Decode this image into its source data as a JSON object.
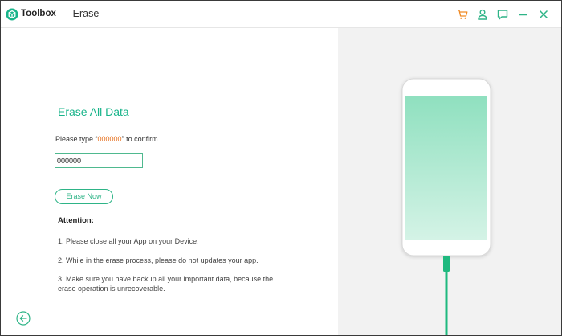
{
  "titlebar": {
    "app_name": "Toolbox",
    "separator_title": "- Erase",
    "icons": [
      "logo-icon",
      "cart-icon",
      "user-icon",
      "feedback-icon",
      "minimize-icon",
      "close-icon"
    ]
  },
  "main": {
    "heading": "Erase All Data",
    "confirm_prefix": "Please type “",
    "confirm_code": "000000",
    "confirm_suffix": "” to confirm",
    "input_value": "000000",
    "erase_button": "Erase Now",
    "attention_label": "Attention:",
    "notes": [
      "1. Please close all your App on your Device.",
      "2. While in the erase process, please do not updates your app.",
      "3. Make sure you have backup all your important data, because the",
      "erase operation is unrecoverable."
    ]
  },
  "colors": {
    "accent": "#18b48a",
    "code": "#e8782a",
    "icon_orange": "#f08a24",
    "icon_green": "#2eb487",
    "screen_top": "#8fe0bf",
    "screen_bottom": "#d4f3e6",
    "cable": "#1fb97f"
  }
}
